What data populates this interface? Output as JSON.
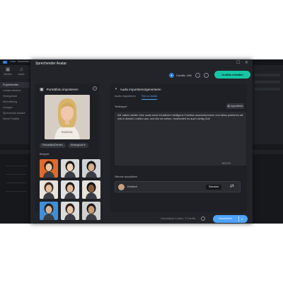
{
  "app": {
    "window_title": "Datei · Bearbeiten",
    "sidebar_tabs": [
      {
        "icon": "media-icon",
        "glyph": "▣",
        "label": "Medien"
      },
      {
        "icon": "audio-icon",
        "glyph": "♫",
        "label": "Audio"
      }
    ],
    "sidebar_items": [
      {
        "label": "Projektmedien",
        "active": true
      },
      {
        "label": "Lokales Medium",
        "active": false
      },
      {
        "label": "Hintergründe",
        "active": false
      },
      {
        "label": "Mit Anleitung",
        "active": false
      },
      {
        "label": "Vorlagen",
        "active": false
      },
      {
        "label": "Sprechende Avatare",
        "active": false
      },
      {
        "label": "Meine Projekte",
        "active": false
      }
    ]
  },
  "dialog": {
    "title": "Sprechender Avatar",
    "credits_label": "Credits: 198",
    "get_credits_label": "Credits erhalten",
    "left_panel": {
      "title": "Porträtfoto importieren",
      "portrait_caption": "SUNDAL",
      "pills": [
        "Freistellen/Drehen",
        "Hintergrund"
      ],
      "examples_label": "Beispiel",
      "thumbnails": [
        {
          "bg": "#e06a2c",
          "skin": "#e8c3a5",
          "hair": "#2b1d14"
        },
        {
          "bg": "#d9d9d9",
          "skin": "#f0d2b8",
          "hair": "#1b1412"
        },
        {
          "bg": "#cfd3d6",
          "skin": "#d9ae8a",
          "hair": "#121212"
        },
        {
          "bg": "#e8e3dc",
          "skin": "#e5bf9c",
          "hair": "#3a2a20"
        },
        {
          "bg": "#dfe2e5",
          "skin": "#e3b894",
          "hair": "#221913"
        },
        {
          "bg": "#e7e2da",
          "skin": "#8a5a3c",
          "hair": "#111111"
        },
        {
          "bg": "#3f8fd9",
          "skin": "#d8b392",
          "hair": "#222222"
        },
        {
          "bg": "#dcdcdc",
          "skin": "#e6c4a4",
          "hair": "#2a1e16"
        },
        {
          "bg": "#d0d0d0",
          "skin": "#c79a74",
          "hair": "#1a1a1a"
        }
      ]
    },
    "right_panel": {
      "title": "Audio importieren/generieren",
      "tabs": [
        {
          "label": "Audio importieren",
          "active": false
        },
        {
          "label": "Text zu Audio",
          "active": true
        }
      ],
      "text_label": "Textkörper",
      "import_label": "Importieren",
      "text_body": "Wir haben wieder eine coole neue künstliche Intelligenz Funktion dazubekommen und diese probieren wir mal in diesem Lektion aus, und wie wir sehen, funktioniert es auch richtig Gut!",
      "char_count": "180/2000",
      "voice_section_label": "Stimme auswählen",
      "voice_language": "Deutsch",
      "voice_badge": "Standard"
    },
    "footer": {
      "note": "Geschätzte Kosten: 3 Credits",
      "generate_label": "Generieren"
    }
  },
  "colors": {
    "accent": "#4fa3ff",
    "credits_button": "#16c5a4",
    "dialog_bg": "#222429",
    "panel_bg": "#1e2025"
  }
}
